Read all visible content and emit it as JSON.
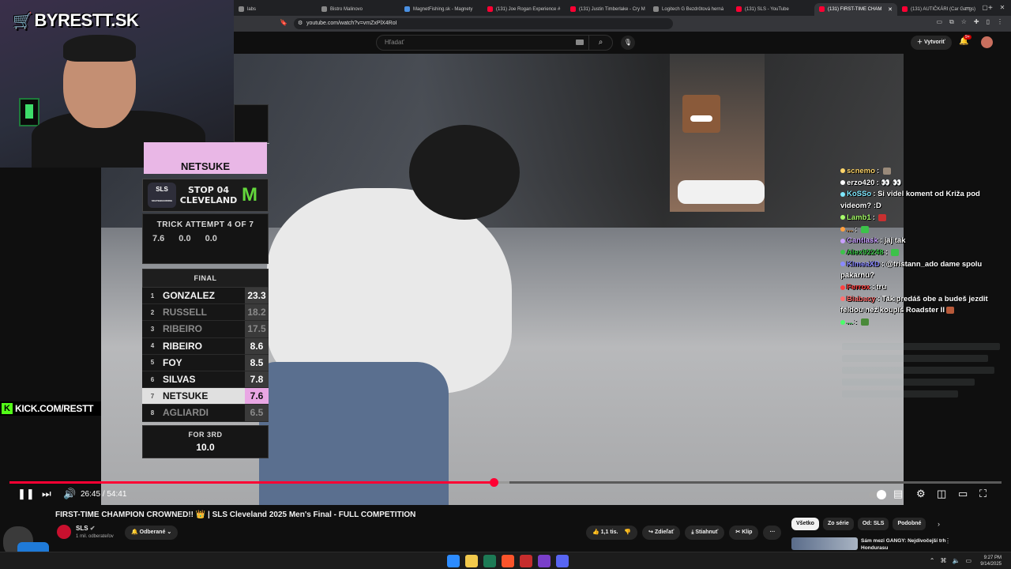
{
  "browser": {
    "tabs": [
      {
        "label": "labs",
        "fav": "grey"
      },
      {
        "label": "Bistro Malinovo",
        "fav": "grey"
      },
      {
        "label": "MagnetFishing.sk - Magnety",
        "fav": "blue"
      },
      {
        "label": "(131) Joe Rogan Experience #",
        "fav": "red"
      },
      {
        "label": "(131) Justin Timberlake - Cry M",
        "fav": "red"
      },
      {
        "label": "Logitech G Bezdrôtová herná",
        "fav": "grey"
      },
      {
        "label": "(131) SLS - YouTube",
        "fav": "red"
      },
      {
        "label": "(131) FIRST-TIME CHAM",
        "fav": "red",
        "active": true
      },
      {
        "label": "(131) AUTIČKÁRI (Car Gangs)",
        "fav": "red"
      }
    ],
    "new_tab": "+",
    "url": "youtube.com/watch?v=vmZxPlX4RoI"
  },
  "youtube": {
    "search_placeholder": "Hľadať",
    "create_label": "Vytvoriť",
    "notif_count": "9+"
  },
  "stream": {
    "brand": "BYRESTT.SK",
    "kick": "KICK.COM/RESTT"
  },
  "scoreboard": {
    "current_rider": "NETSUKE",
    "event_logo": "SLS",
    "event_sub": "SKATEBOARDING",
    "stop_line1": "STOP 04",
    "stop_line2": "CLEVELAND",
    "sponsor": "M",
    "trick_title": "TRICK ATTEMPT 4 OF 7",
    "trick_scores": [
      "7.6",
      "0.0",
      "0.0"
    ],
    "final_label": "FINAL",
    "rows": [
      {
        "rank": "1",
        "name": "GONZALEZ",
        "score": "23.3",
        "style": ""
      },
      {
        "rank": "2",
        "name": "RUSSELL",
        "score": "18.2",
        "style": "dim"
      },
      {
        "rank": "3",
        "name": "RIBEIRO",
        "score": "17.5",
        "style": "dim"
      },
      {
        "rank": "4",
        "name": "RIBEIRO",
        "score": "8.6",
        "style": ""
      },
      {
        "rank": "5",
        "name": "FOY",
        "score": "8.5",
        "style": ""
      },
      {
        "rank": "6",
        "name": "SILVAS",
        "score": "7.8",
        "style": ""
      },
      {
        "rank": "7",
        "name": "NETSUKE",
        "score": "7.6",
        "style": "hl"
      },
      {
        "rank": "8",
        "name": "AGLIARDI",
        "score": "6.5",
        "style": "dim"
      }
    ],
    "for_label": "FOR 3RD",
    "for_value": "10.0"
  },
  "chat": [
    {
      "user": "scnemo",
      "text": "",
      "color": "#ffd66b",
      "emote": "#9a8a7a"
    },
    {
      "user": "erzo420",
      "text": "👀 👀",
      "color": "#ffffff",
      "emote": ""
    },
    {
      "user": "KoSSo",
      "text": "Si videl koment od Križa pod videom? :D",
      "color": "#7ee8ff",
      "emote": "",
      "wrap": true
    },
    {
      "user": "Lamb1",
      "text": "",
      "color": "#a8ff6b",
      "emote": "#c83030"
    },
    {
      "user": "...",
      "text": "",
      "color": "#ffa040",
      "emote": "#3cc24a"
    },
    {
      "user": "Cantlask",
      "text": "jaj tak",
      "color": "#c9a0ff",
      "emote": ""
    },
    {
      "user": "Alex92248",
      "text": "",
      "color": "#3cc24a",
      "emote": "#3cc24a"
    },
    {
      "user": "KlmeaXD",
      "text": "@tristann_ado dame spolu pakarnu?",
      "color": "#8a8aff",
      "emote": "",
      "wrap": true
    },
    {
      "user": "Ferrox",
      "text": "tru",
      "color": "#ff4040",
      "emote": ""
    },
    {
      "user": "Biabacy",
      "text": "Tak predáš obe a budeš jezdit feldou než koupíš Roadster II",
      "color": "#ff7070",
      "emote": "#b85a3a",
      "wrap": true
    },
    {
      "user": "...",
      "text": "",
      "color": "#4aff6a",
      "emote": "#4a8a3a"
    }
  ],
  "player": {
    "played_pct": 48.8,
    "buffered_pct": 50.4,
    "current_time": "26:45",
    "sep": "/",
    "duration": "54:41"
  },
  "video": {
    "title": "FIRST-TIME CHAMPION CROWNED!! 👑 | SLS Cleveland 2025 Men's Final - FULL COMPETITION",
    "channel": "SLS",
    "subs": "1 mil. odberateľov",
    "subscribed_label": "Odberané",
    "likes": "1,1 tis.",
    "share": "Zdieľať",
    "download": "Stiahnuť",
    "clip": "Klip",
    "more": "···"
  },
  "chips": [
    {
      "label": "Všetko",
      "on": true
    },
    {
      "label": "Zo série",
      "on": false
    },
    {
      "label": "Od: SLS",
      "on": false
    },
    {
      "label": "Podobné",
      "on": false
    }
  ],
  "recommended": {
    "title": "Sám mezi GANGY: Nejdivočejší trh Hondurasu"
  },
  "taskbar": {
    "time": "9:27 PM",
    "date": "9/14/2025"
  }
}
